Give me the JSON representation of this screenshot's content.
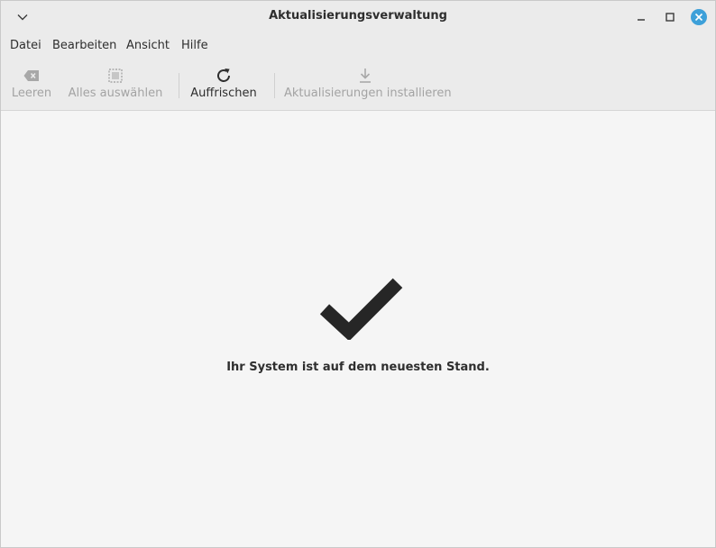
{
  "window": {
    "title": "Aktualisierungsverwaltung"
  },
  "menubar": {
    "items": [
      {
        "label": "Datei"
      },
      {
        "label": "Bearbeiten"
      },
      {
        "label": "Ansicht"
      },
      {
        "label": "Hilfe"
      }
    ]
  },
  "toolbar": {
    "clear_label": "Leeren",
    "select_all_label": "Alles auswählen",
    "refresh_label": "Auffrischen",
    "install_label": "Aktualisierungen installieren"
  },
  "main": {
    "status_message": "Ihr System ist auf dem neuesten Stand."
  },
  "icons": {
    "clear": "backspace-icon",
    "select_all": "select-all-icon",
    "refresh": "refresh-icon",
    "install": "download-icon",
    "status": "checkmark-icon"
  },
  "colors": {
    "close_button": "#3da0d9",
    "disabled_text": "#a3a3a3",
    "text": "#2e2e2e"
  }
}
